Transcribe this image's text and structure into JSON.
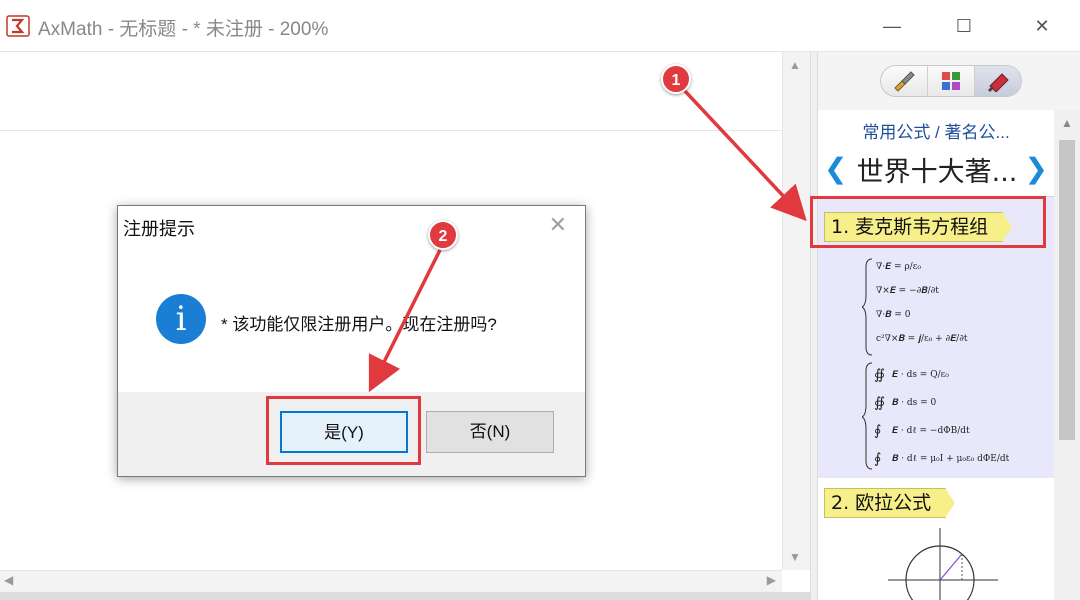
{
  "window": {
    "title": "AxMath - 无标题 - * 未注册 - 200%",
    "minimize_glyph": "—",
    "maximize_glyph": "☐",
    "close_glyph": "✕"
  },
  "panel": {
    "breadcrumb": "常用公式 / 著名公...",
    "category_title": "世界十大著...",
    "prev_glyph": "❮",
    "next_glyph": "❯",
    "toolbar_icons": [
      "brush-icon",
      "grid-icon",
      "bookmark-icon"
    ],
    "formulas": [
      {
        "label": "1. 麦克斯韦方程组"
      },
      {
        "label": "2. 欧拉公式"
      }
    ]
  },
  "dialog": {
    "title": "注册提示",
    "close_glyph": "✕",
    "icon_glyph": "i",
    "message": "* 该功能仅限注册用户。现在注册吗?",
    "yes_label": "是(Y)",
    "no_label": "否(N)"
  },
  "annotations": {
    "marker1": "1",
    "marker2": "2",
    "color": "#e0393e"
  },
  "colors": {
    "accent": "#0078d7",
    "link": "#1e4f9a",
    "tag": "#f7f08a",
    "card": "#e8e8fa",
    "info": "#1a7fd4"
  }
}
